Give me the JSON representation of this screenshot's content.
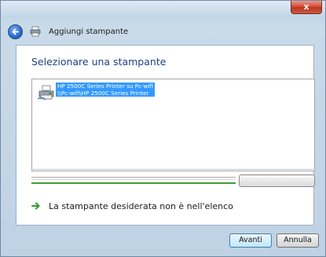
{
  "window": {
    "title": "Aggiungi stampante",
    "close_glyph": "x"
  },
  "main": {
    "heading": "Selezionare una stampante",
    "printers": [
      {
        "line1": "HP 2500C Series Printer su Pc-wifi",
        "line2": "\\\\Pc-wifi\\HP 2500C Series Printer"
      }
    ],
    "search_button_label": "",
    "not_listed_link": "La stampante desiderata non è nell'elenco"
  },
  "footer": {
    "next_label": "Avanti",
    "cancel_label": "Annulla"
  },
  "icons": [
    "close-icon",
    "back-arrow-icon",
    "printer-icon",
    "green-arrow-icon"
  ],
  "colors": {
    "heading": "#1e3f88",
    "selection": "#3399ff",
    "progress": "#3aa13a",
    "close": "#c8452d"
  }
}
